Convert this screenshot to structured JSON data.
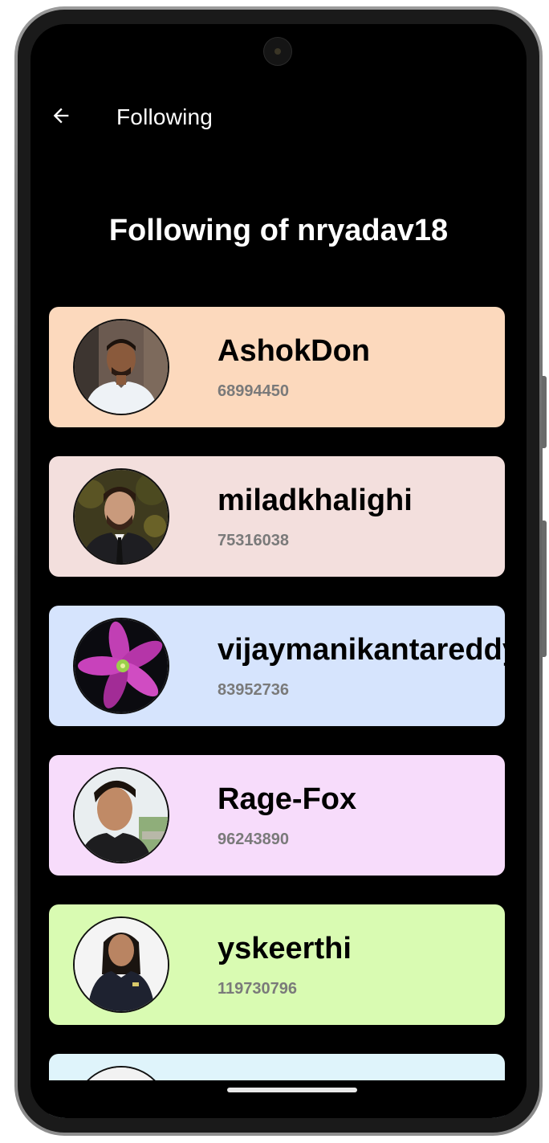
{
  "app_bar": {
    "back_icon": "arrow-left-icon",
    "title": "Following"
  },
  "heading": "Following of nryadav18",
  "users": [
    {
      "name": "AshokDon",
      "id": "68994450",
      "bg": "#fcd9bd",
      "avatar": "photo-man-white-shirt"
    },
    {
      "name": "miladkhalighi",
      "id": "75316038",
      "bg": "#f3dfdd",
      "avatar": "photo-man-suit"
    },
    {
      "name": "vijaymanikantareddy",
      "id": "83952736",
      "bg": "#d6e4fd",
      "avatar": "photo-purple-flower"
    },
    {
      "name": "Rage-Fox",
      "id": "96243890",
      "bg": "#f7dcfb",
      "avatar": "photo-young-man"
    },
    {
      "name": "yskeerthi",
      "id": "119730796",
      "bg": "#d9fbb2",
      "avatar": "photo-woman-black-shirt"
    },
    {
      "name": "",
      "id": "",
      "bg": "#dff4fb",
      "avatar": "photo-partial"
    }
  ],
  "colors": {
    "screen_bg": "#000000",
    "title_text": "#ffffff",
    "name_text": "#000000",
    "id_text": "#7a7a7a"
  }
}
